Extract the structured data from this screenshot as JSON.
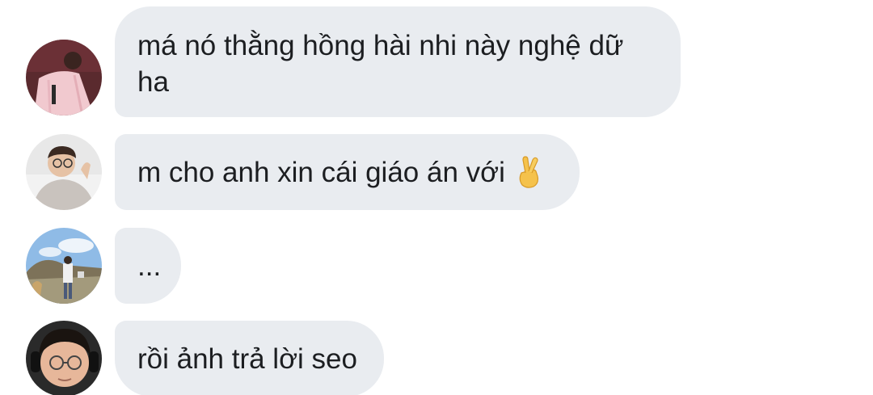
{
  "messages": [
    {
      "text": "má nó thằng hồng hài nhi này nghệ dữ\nha",
      "avatar": "avatar-pink-jacket"
    },
    {
      "text": "m cho anh xin cái giáo án với",
      "emoji": "crossed-fingers-icon",
      "avatar": "avatar-glasses-hoodie"
    },
    {
      "text": "...",
      "avatar": "avatar-outdoor-field"
    },
    {
      "text": "rồi ảnh trả lời seo",
      "avatar": "avatar-headphones-glasses"
    }
  ],
  "colors": {
    "bubble": "#e9ecf0",
    "text": "#1c1e21",
    "background": "#ffffff"
  }
}
